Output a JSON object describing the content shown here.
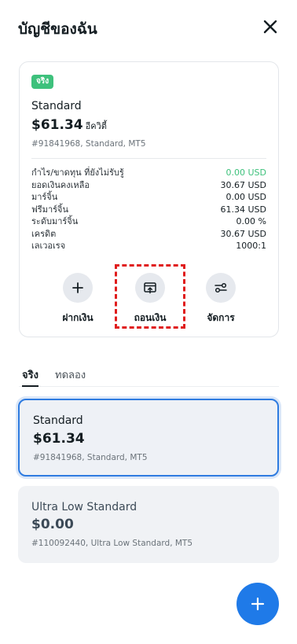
{
  "header": {
    "title": "บัญชีของฉัน",
    "close_icon": "close-icon"
  },
  "account_card": {
    "badge": "จริง",
    "name": "Standard",
    "balance": "$61.34",
    "currency_label": "อีควิตี้",
    "meta": "#91841968, Standard, MT5",
    "stats": [
      {
        "label": "กำไร/ขาดทุน ที่ยังไม่รับรู้",
        "value": "0.00 USD",
        "positive": true
      },
      {
        "label": "ยอดเงินคงเหลือ",
        "value": "30.67 USD",
        "positive": false
      },
      {
        "label": "มาร์จิ้น",
        "value": "0.00 USD",
        "positive": false
      },
      {
        "label": "ฟรีมาร์จิ้น",
        "value": "61.34 USD",
        "positive": false
      },
      {
        "label": "ระดับมาร์จิ้น",
        "value": "0.00 %",
        "positive": false
      },
      {
        "label": "เครดิต",
        "value": "30.67 USD",
        "positive": false
      },
      {
        "label": "เลเวอเรจ",
        "value": "1000:1",
        "positive": false
      }
    ],
    "actions": [
      {
        "label": "ฝากเงิน",
        "icon": "plus-icon"
      },
      {
        "label": "ถอนเงิน",
        "icon": "withdraw-icon"
      },
      {
        "label": "จัดการ",
        "icon": "settings-sliders-icon"
      }
    ]
  },
  "tabs": [
    {
      "label": "จริง",
      "active": true
    },
    {
      "label": "ทดลอง",
      "active": false
    }
  ],
  "account_list": [
    {
      "name": "Standard",
      "balance": "$61.34",
      "meta": "#91841968, Standard, MT5",
      "selected": true
    },
    {
      "name": "Ultra Low Standard",
      "balance": "$0.00",
      "meta": "#110092440, Ultra Low Standard, MT5",
      "selected": false
    }
  ],
  "fab": {
    "icon": "plus-icon"
  },
  "colors": {
    "accent": "#1f7ae8",
    "positive": "#3ec17c",
    "highlight": "#e01d1d",
    "selected_border": "#2e7be0"
  }
}
